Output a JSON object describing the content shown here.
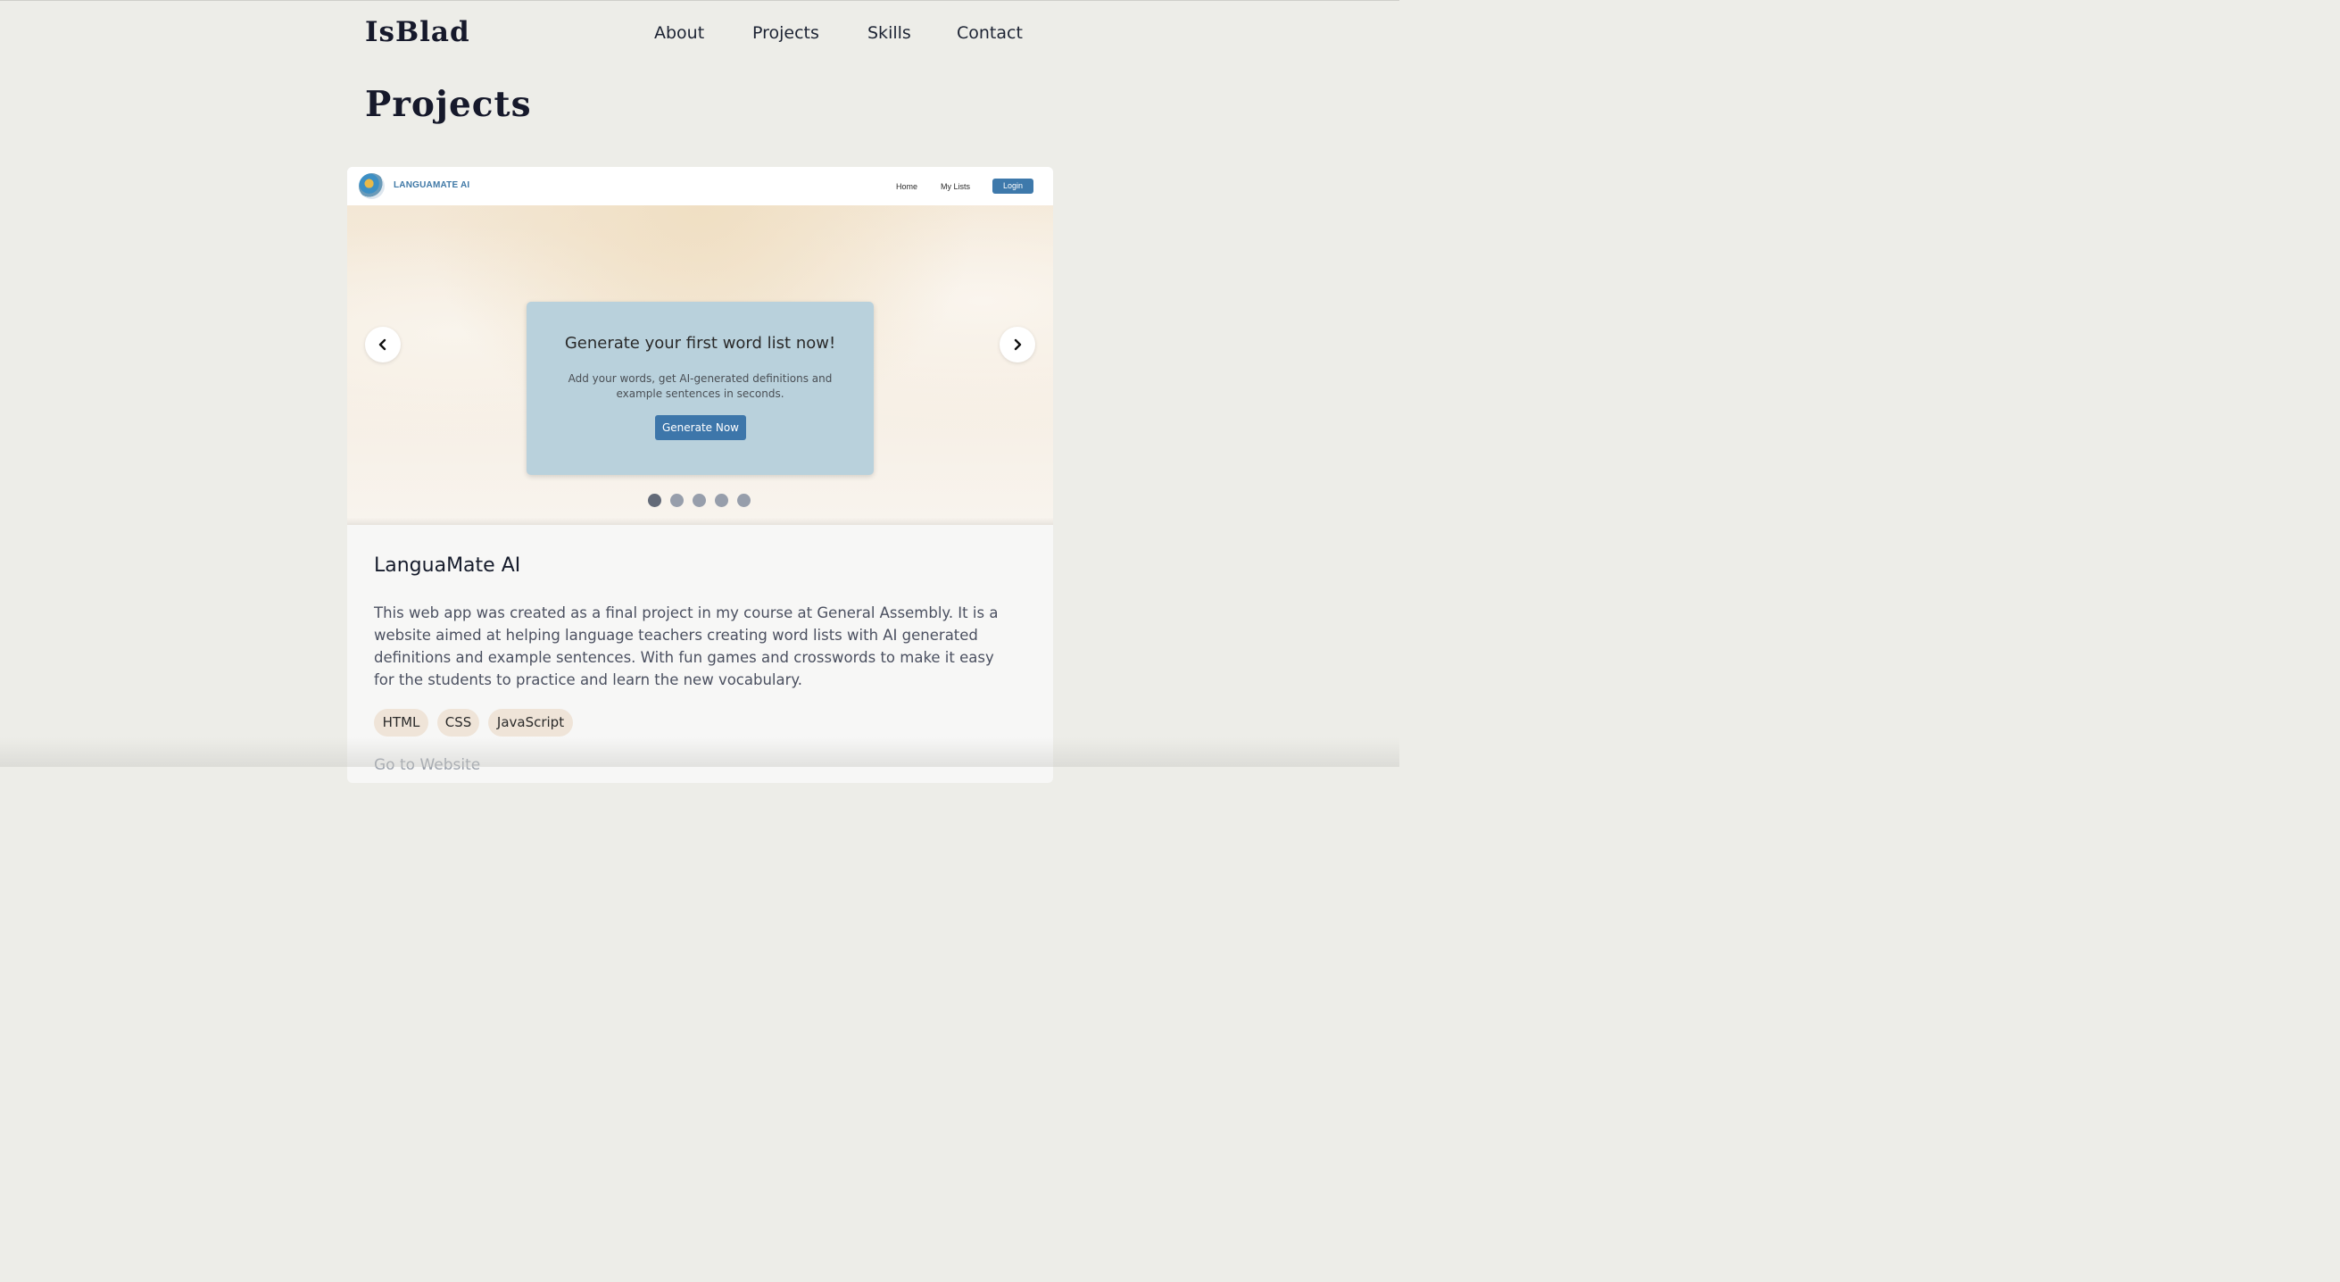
{
  "site": {
    "logo": "IsBlad",
    "nav": [
      "About",
      "Projects",
      "Skills",
      "Contact"
    ]
  },
  "page_title": "Projects",
  "project": {
    "screenshot": {
      "brand": "LANGUAMATE AI",
      "nav": [
        "Home",
        "My Lists"
      ],
      "login": "Login",
      "hero_title": "Generate your first word list now!",
      "hero_subtitle": "Add your words, get AI-generated definitions and example sentences in seconds.",
      "hero_button": "Generate Now",
      "slides_total": 5,
      "active_slide": 1
    },
    "title": "LanguaMate AI",
    "description": "This web app was created as a final project in my course at General Assembly. It is a website aimed at helping language teachers creating word lists with AI generated definitions and example sentences. With fun games and crosswords to make it easy for the students to practice and learn the new vocabulary.",
    "tags": [
      "HTML",
      "CSS",
      "JavaScript"
    ],
    "link": "Go to Website"
  },
  "colors": {
    "page_bg": "#edede8",
    "card_bg": "#f7f7f6",
    "accent_blue": "#3d76aa",
    "hero_box": "#b9d1dc",
    "tag_bg": "#efe4d8"
  }
}
